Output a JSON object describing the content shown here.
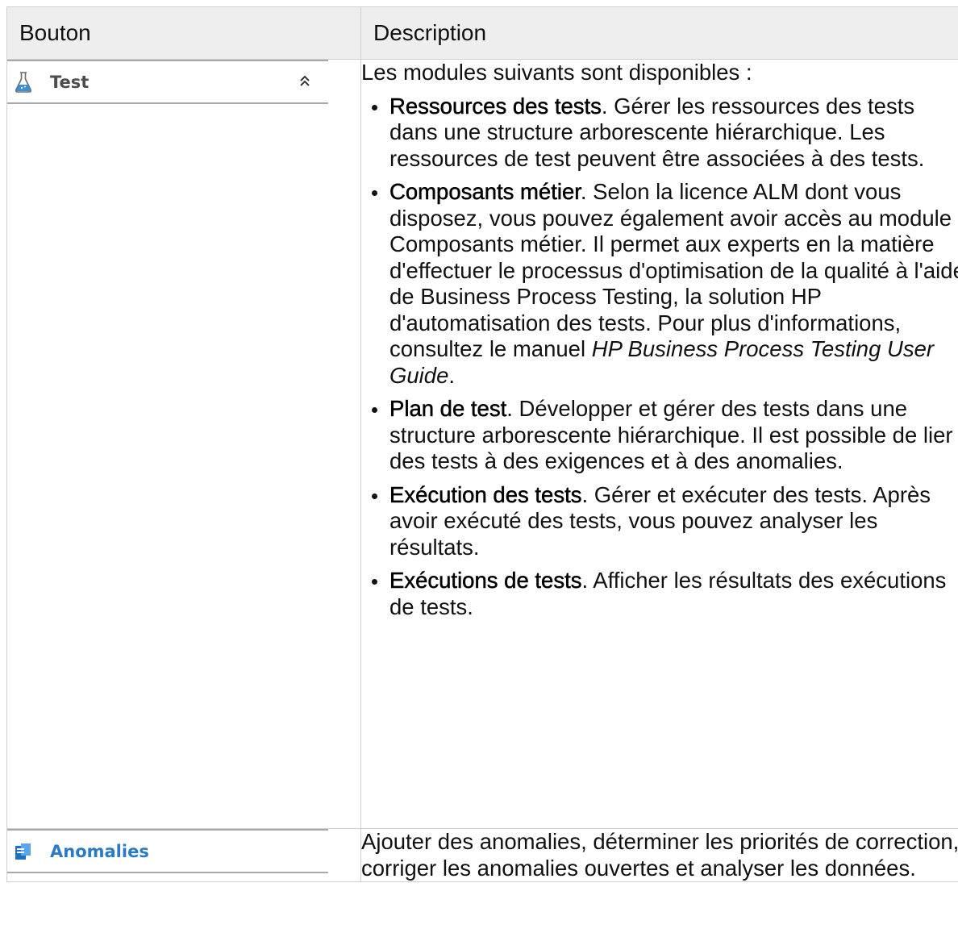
{
  "table": {
    "headers": [
      "Bouton",
      "Description"
    ]
  },
  "rows": [
    {
      "button": {
        "label": "Test",
        "icon": "flask-icon",
        "collapse_icon": "double-chevron-up-icon"
      },
      "intro": "Les modules suivants sont disponibles :",
      "items": [
        {
          "title": "Ressources des tests",
          "text": ". Gérer les ressources des tests dans une structure arborescente hiérarchique. Les ressources de test peuvent être associées à des tests."
        },
        {
          "title": "Composants métier",
          "text": ". Selon la licence ALM dont vous disposez, vous pouvez également avoir accès au module Composants métier. Il permet aux experts en la matière d'effectuer le processus d'optimisation de la qualité à l'aide de Business Process Testing, la solution HP d'automatisation des tests. Pour plus d'informations, consultez le manuel ",
          "italic": "HP Business Process Testing User Guide",
          "tail": "."
        },
        {
          "title": "Plan de test",
          "text": ". Développer et gérer des tests dans une structure arborescente hiérarchique. Il est possible de lier des tests à des exigences et à des anomalies."
        },
        {
          "title": "Exécution des tests",
          "text": ". Gérer et exécuter des tests. Après avoir exécuté des tests, vous pouvez analyser les résultats."
        },
        {
          "title": "Exécutions de tests",
          "text": ". Afficher les résultats des exécutions de tests."
        }
      ]
    },
    {
      "button": {
        "label": "Anomalies",
        "icon": "defects-icon"
      },
      "description": "Ajouter des anomalies, déterminer les priorités de correction, corriger les anomalies ouvertes et analyser les données."
    }
  ],
  "colors": {
    "header_bg": "#eeeeee",
    "border": "#cfcfcf",
    "anomalies_label": "#2a7ac6"
  }
}
